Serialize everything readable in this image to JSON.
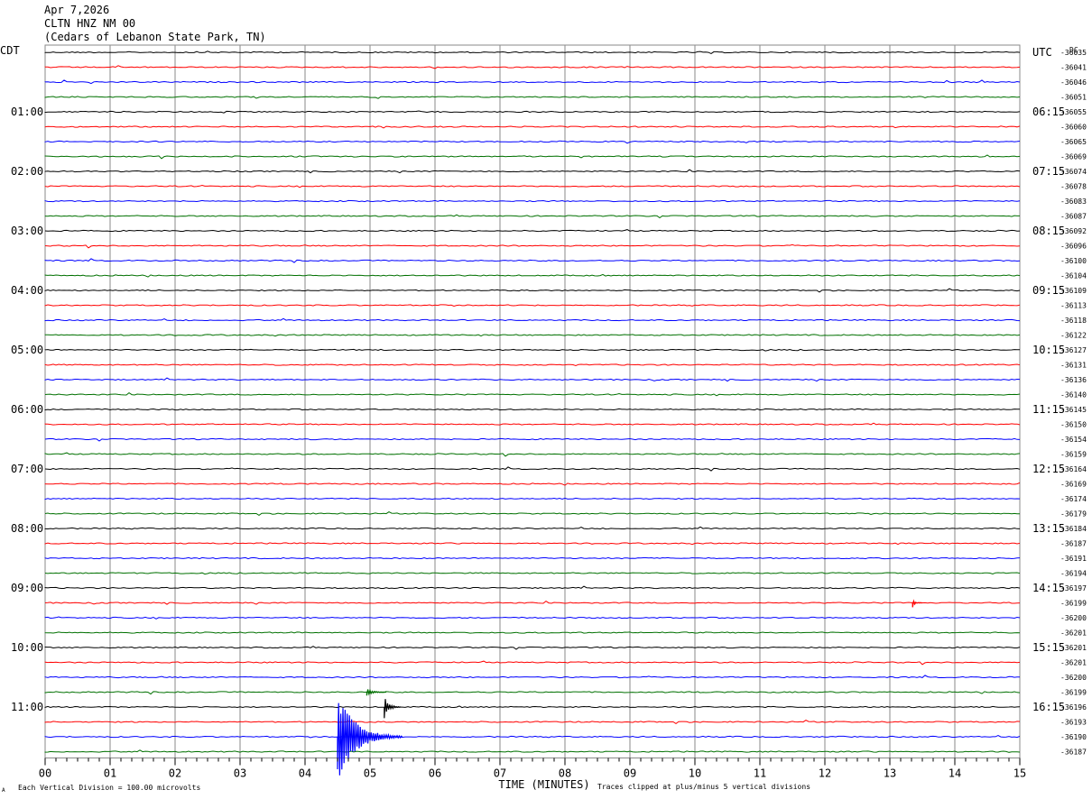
{
  "header": {
    "date": "Apr 7,2026",
    "station": "CLTN HNZ NM 00",
    "location": "(Cedars of Lebanon State Park, TN)"
  },
  "left_zone": "CDT",
  "right_zone": "UTC",
  "dc_label": "DC",
  "footer": {
    "xlabel": "TIME (MINUTES)",
    "scale_note": "Each Vertical Division =  100.00 microvolts",
    "clip_note": "Traces clipped at plus/minus 5 vertical divisions",
    "corner_mark": "A"
  },
  "colors": {
    "trace_cycle": [
      "#000000",
      "#ff0000",
      "#0000ff",
      "#007000"
    ],
    "grid": "#8a8a8a",
    "text": "#000000"
  },
  "chart_data": {
    "type": "line",
    "title": "CLTN HNZ NM 00",
    "xlabel": "TIME (MINUTES)",
    "xlim": [
      0,
      15
    ],
    "x_ticks": [
      "00",
      "01",
      "02",
      "03",
      "04",
      "05",
      "06",
      "07",
      "08",
      "09",
      "10",
      "11",
      "12",
      "13",
      "14",
      "15"
    ],
    "trace_count": 48,
    "trace_minutes": 15,
    "grid": true,
    "left_time_labels": [
      {
        "trace": 4,
        "text": "01:00"
      },
      {
        "trace": 8,
        "text": "02:00"
      },
      {
        "trace": 12,
        "text": "03:00"
      },
      {
        "trace": 16,
        "text": "04:00"
      },
      {
        "trace": 20,
        "text": "05:00"
      },
      {
        "trace": 24,
        "text": "06:00"
      },
      {
        "trace": 28,
        "text": "07:00"
      },
      {
        "trace": 32,
        "text": "08:00"
      },
      {
        "trace": 36,
        "text": "09:00"
      },
      {
        "trace": 40,
        "text": "10:00"
      },
      {
        "trace": 44,
        "text": "11:00"
      }
    ],
    "right_time_labels": [
      {
        "trace": 0,
        "text": "UTC"
      },
      {
        "trace": 4,
        "text": "06:15"
      },
      {
        "trace": 8,
        "text": "07:15"
      },
      {
        "trace": 12,
        "text": "08:15"
      },
      {
        "trace": 16,
        "text": "09:15"
      },
      {
        "trace": 20,
        "text": "10:15"
      },
      {
        "trace": 24,
        "text": "11:15"
      },
      {
        "trace": 28,
        "text": "12:15"
      },
      {
        "trace": 32,
        "text": "13:15"
      },
      {
        "trace": 36,
        "text": "14:15"
      },
      {
        "trace": 40,
        "text": "15:15"
      },
      {
        "trace": 44,
        "text": "16:15"
      }
    ],
    "dc_offsets": [
      "-36035",
      "-36041",
      "-36046",
      "-36051",
      "-36055",
      "-36060",
      "-36065",
      "-36069",
      "-36074",
      "-36078",
      "-36083",
      "-36087",
      "-36092",
      "-36096",
      "-36100",
      "-36104",
      "-36109",
      "-36113",
      "-36118",
      "-36122",
      "-36127",
      "-36131",
      "-36136",
      "-36140",
      "-36145",
      "-36150",
      "-36154",
      "-36159",
      "-36164",
      "-36169",
      "-36174",
      "-36179",
      "-36184",
      "-36187",
      "-36191",
      "-36194",
      "-36197",
      "-36199",
      "-36200",
      "-36201",
      "-36201",
      "-36201",
      "-36200",
      "-36199",
      "-36196",
      "-36193",
      "-36190",
      "-36187"
    ],
    "events": [
      {
        "trace": 37,
        "minute": 13.35,
        "amplitude": 0.35,
        "duration": 0.15,
        "type": "spike"
      },
      {
        "trace": 44,
        "minute": 5.22,
        "amplitude": 0.8,
        "duration": 0.25,
        "type": "quake"
      },
      {
        "trace": 46,
        "minute": 4.5,
        "amplitude": 3.0,
        "duration": 1.0,
        "type": "quake"
      },
      {
        "trace": 43,
        "minute": 4.95,
        "amplitude": 0.25,
        "duration": 0.3,
        "type": "quake"
      }
    ]
  }
}
